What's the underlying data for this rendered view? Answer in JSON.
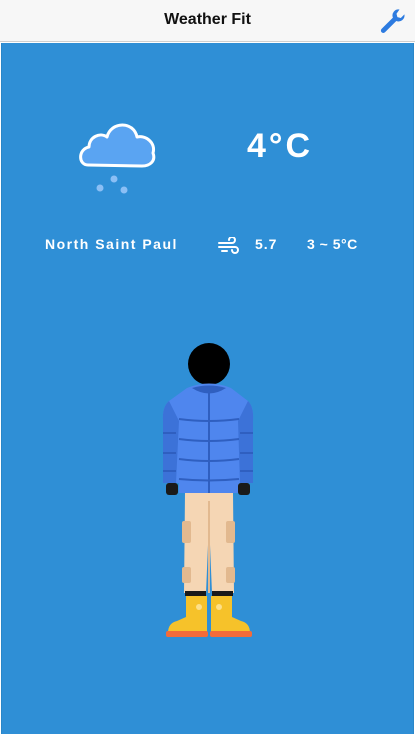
{
  "appbar": {
    "title": "Weather Fit",
    "settings_icon": "wrench-icon"
  },
  "weather": {
    "condition_icon": "cloud-snow-icon",
    "temperature": "4°C",
    "location": "North Saint Paul",
    "wind_icon": "wind-icon",
    "wind_speed": "5.7",
    "temp_range": "3 ~ 5°C"
  },
  "outfit": {
    "items": [
      "avatar-head",
      "puffer-jacket",
      "gloves",
      "cargo-pants",
      "rain-boots"
    ]
  },
  "colors": {
    "background": "#2f8fd6",
    "jacket": "#4f86ee",
    "pants": "#f5d6b4",
    "boots": "#f6c22a",
    "accent": "#2d7be0"
  }
}
